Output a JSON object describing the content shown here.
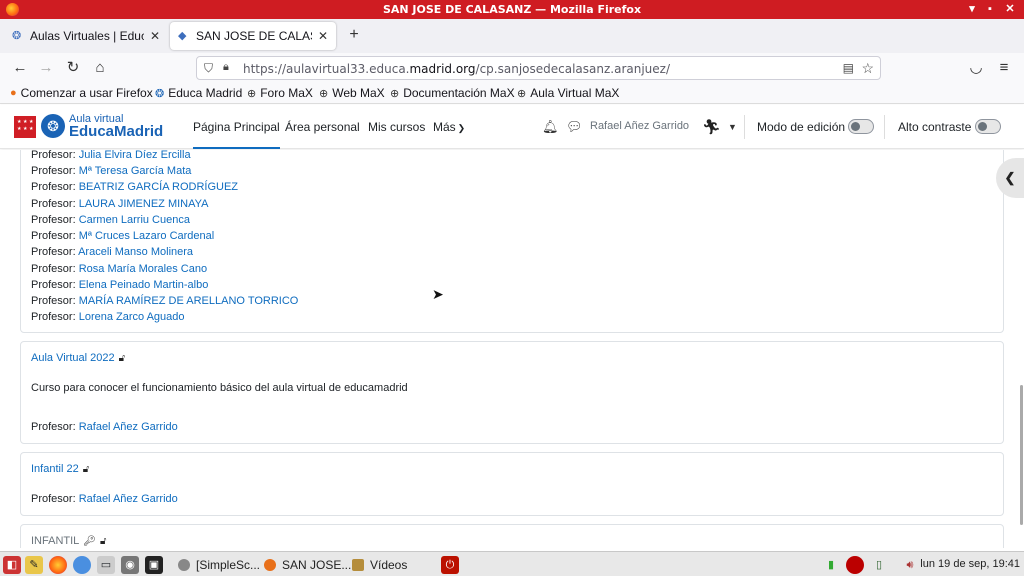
{
  "window": {
    "title": "SAN JOSE DE CALASANZ — Mozilla Firefox"
  },
  "tabs": [
    {
      "label": "Aulas Virtuales | EducaM",
      "icon": "educamadrid-icon"
    },
    {
      "label": "SAN JOSE DE CALASANZ",
      "icon": "course-icon"
    }
  ],
  "url": {
    "prefix": "https://aulavirtual33.educa.",
    "domain": "madrid.org",
    "path": "/cp.sanjosedecalasanz.aranjuez/"
  },
  "bookmarks": [
    "Comenzar a usar Firefox",
    "Educa Madrid",
    "Foro MaX",
    "Web MaX",
    "Documentación MaX",
    "Aula Virtual MaX"
  ],
  "site": {
    "logo_small": "Aula virtual",
    "logo_big": "EducaMadrid",
    "nav": [
      "Página Principal",
      "Área personal",
      "Mis cursos",
      "Más"
    ],
    "user": "Rafael Añez Garrido",
    "edit_mode": "Modo de edición",
    "high_contrast": "Alto contraste"
  },
  "professor_label": "Profesor:",
  "first_course_professors": [
    "Julia Elvira Díez Ercilla",
    "Mª Teresa García Mata",
    "BEATRIZ GARCÍA RODRÍGUEZ",
    "LAURA JIMENEZ MINAYA",
    "Carmen Larriu Cuenca",
    "Mª Cruces Lazaro Cardenal",
    "Araceli Manso Molinera",
    "Rosa María Morales Cano",
    "Elena Peinado Martin-albo",
    "MARÍA RAMÍREZ DE ARELLANO TORRICO",
    "Lorena Zarco Aguado"
  ],
  "courses": [
    {
      "title": "Aula Virtual 2022",
      "description": "Curso para conocer el funcionamiento básico del aula virtual de educamadrid",
      "professor": "Rafael Añez Garrido"
    },
    {
      "title": "Infantil 22",
      "professor": "Rafael Añez Garrido"
    },
    {
      "title": "INFANTIL"
    }
  ],
  "taskbar": {
    "tasks": [
      "[SimpleSc...",
      "SAN JOSE...",
      "Vídeos"
    ],
    "clock": "lun 19 de sep, 19:41"
  }
}
